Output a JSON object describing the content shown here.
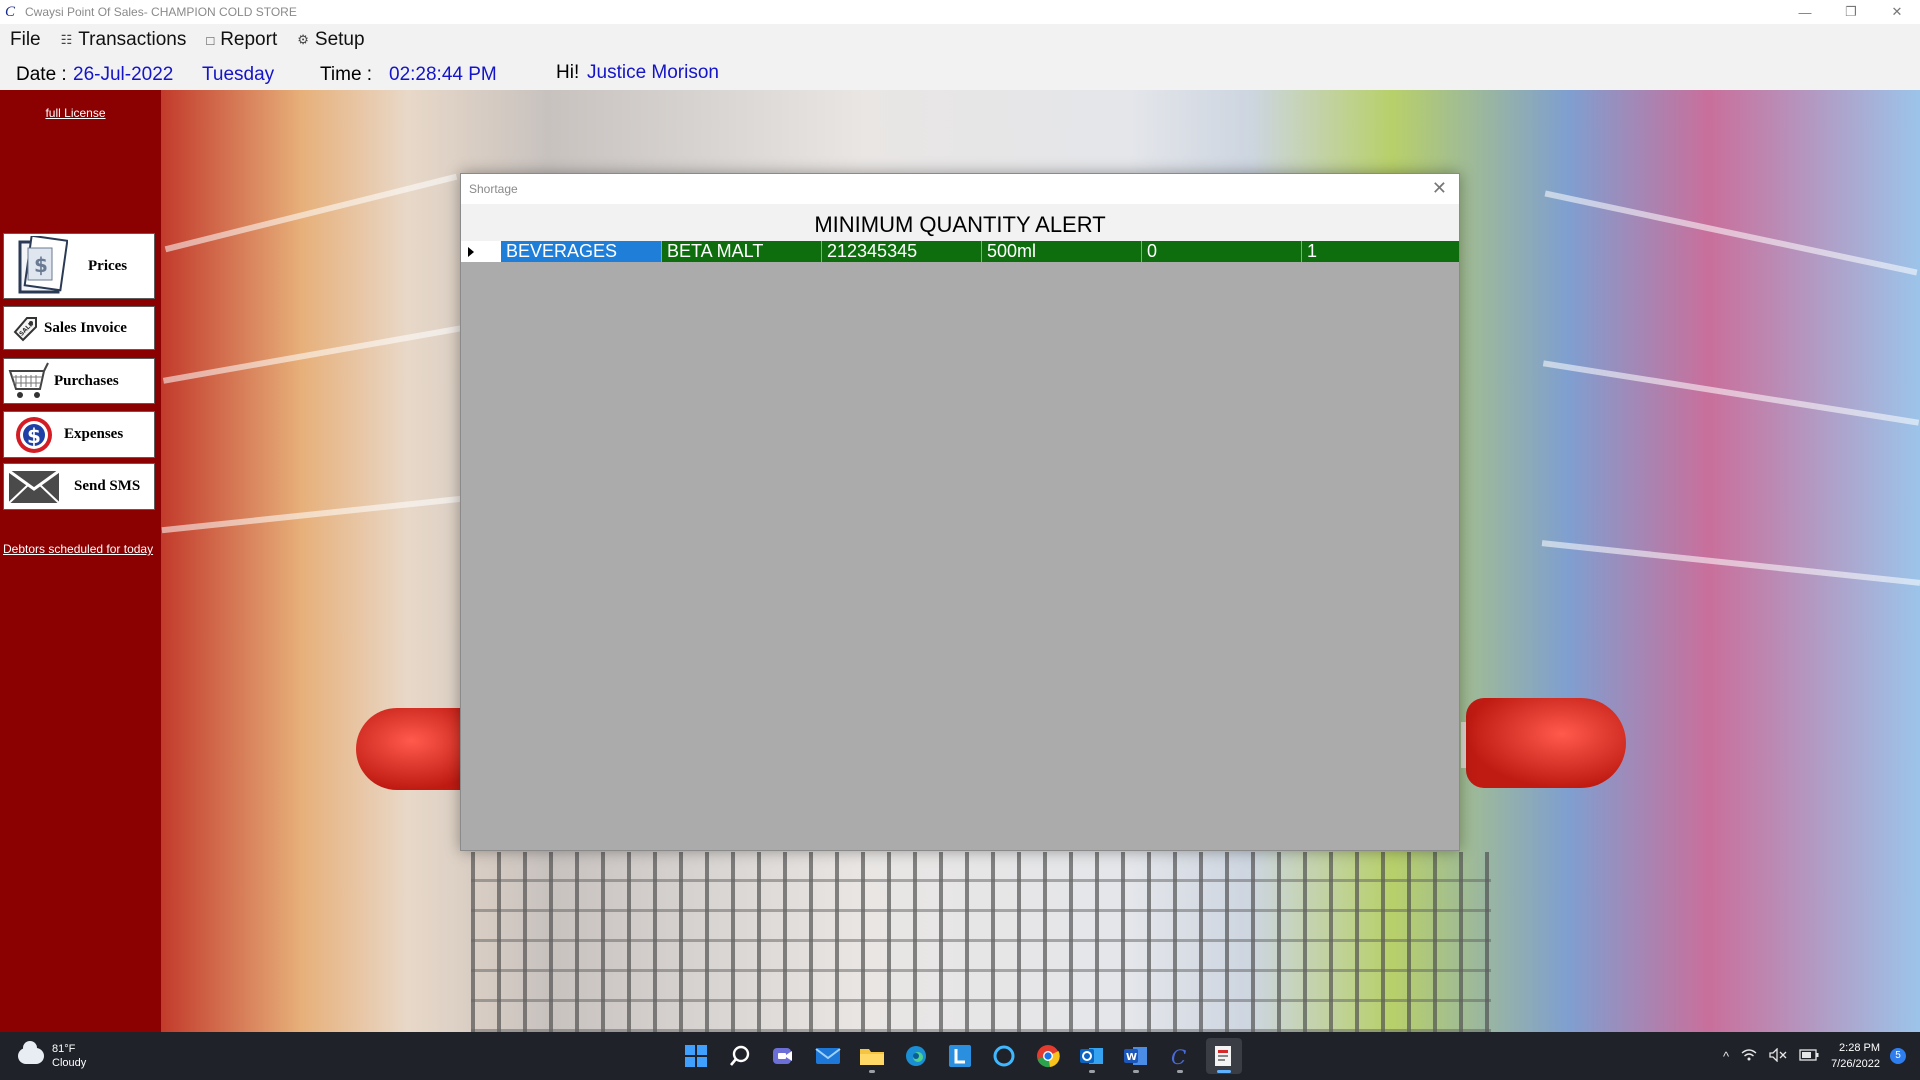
{
  "window": {
    "title": "Cwaysi Point Of Sales- CHAMPION COLD STORE",
    "logo_char": "C",
    "controls": {
      "minimize": "—",
      "restore": "❐",
      "close": "✕"
    }
  },
  "menu": {
    "items": [
      {
        "label": "File",
        "icon": ""
      },
      {
        "label": "Transactions",
        "icon": "transactions-icon"
      },
      {
        "label": "Report",
        "icon": "report-icon"
      },
      {
        "label": "Setup",
        "icon": "setup-gear-icon"
      }
    ]
  },
  "info": {
    "date_label": "Date :",
    "date": "26-Jul-2022",
    "day": "Tuesday",
    "time_label": "Time :",
    "time": "02:28:44 PM",
    "greeting": "Hi!",
    "user": "Justice Morison"
  },
  "sidebar": {
    "license_link": "full License",
    "buttons": [
      {
        "label": "Prices",
        "icon": "dollar-document-icon"
      },
      {
        "label": "Sales Invoice",
        "icon": "sale-tag-icon"
      },
      {
        "label": "Purchases",
        "icon": "shopping-cart-icon"
      },
      {
        "label": "Expenses",
        "icon": "dollar-circle-icon"
      },
      {
        "label": "Send SMS",
        "icon": "envelope-icon"
      }
    ],
    "debtors_link": "Debtors scheduled for today"
  },
  "dialog": {
    "title": "Shortage",
    "close": "✕",
    "header": "MINIMUM QUANTITY ALERT",
    "rows": [
      {
        "category": "BEVERAGES",
        "product": "BETA MALT",
        "code": "212345345",
        "size": "500ml",
        "quantity": "0",
        "minimum": "1"
      }
    ]
  },
  "taskbar": {
    "weather_temp": "81°F",
    "weather_desc": "Cloudy",
    "apps": [
      "start-icon",
      "search-icon",
      "teams-icon",
      "mail-icon",
      "file-explorer-icon",
      "edge-icon",
      "l-app-icon",
      "cortana-icon",
      "chrome-icon",
      "outlook-icon",
      "word-icon",
      "cwaysi-icon",
      "pos-app-icon"
    ],
    "tray_chevron": "^",
    "clock_time": "2:28 PM",
    "clock_date": "7/26/2022",
    "notification_count": "5"
  },
  "colors": {
    "sidebar_bg": "#8b0000",
    "alert_row": "#0e6e0e",
    "selected_cell": "#1f7fd8",
    "info_value": "#1414c8"
  }
}
